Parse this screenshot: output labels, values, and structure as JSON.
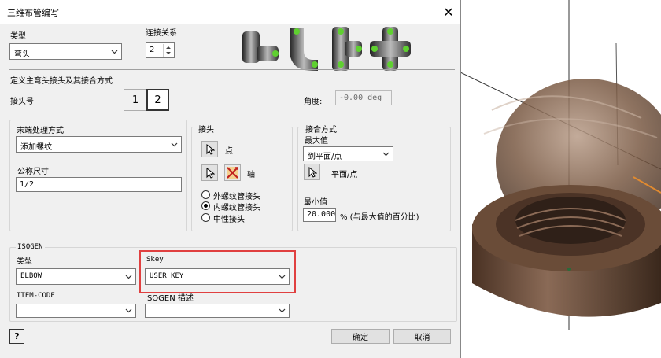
{
  "dialog": {
    "title": "三维布管编写",
    "type_label": "类型",
    "type_value": "弯头",
    "connections_label": "连接关系",
    "connections_value": "2",
    "define_header": "定义主弯头接头及其接合方式",
    "connector_label": "接头号",
    "connector_buttons": [
      "1",
      "2"
    ],
    "angle_label": "角度:",
    "angle_value": "-0.00 deg",
    "end_treatment": {
      "title": "末端处理方式",
      "value": "添加螺纹",
      "nominal_size_label": "公称尺寸",
      "nominal_size_value": "1/2"
    },
    "connector": {
      "title": "接头",
      "point_label": "点",
      "axis_label": "轴",
      "radios": [
        {
          "label": "外螺纹管接头",
          "selected": false
        },
        {
          "label": "内螺纹管接头",
          "selected": true
        },
        {
          "label": "中性接头",
          "selected": false
        }
      ]
    },
    "engagement": {
      "title": "接合方式",
      "max_label": "最大值",
      "max_value": "到平面/点",
      "plane_point_label": "平面/点",
      "min_label": "最小值",
      "min_value": "20.000",
      "min_suffix": "% (与最大值的百分比)"
    },
    "isogen": {
      "title": "ISOGEN",
      "type_label": "类型",
      "type_value": "ELBOW",
      "skey_label": "Skey",
      "skey_value": "USER_KEY",
      "item_code_label": "ITEM-CODE",
      "item_code_value": "",
      "desc_label": "ISOGEN 描述",
      "desc_value": ""
    },
    "ok_label": "确定",
    "cancel_label": "取消",
    "help_label": "?"
  },
  "colors": {
    "highlight_box": "#e04040",
    "title_bg": "#ffffff",
    "dialog_bg": "#f0f0f0",
    "model_brown": "#6b4a36"
  }
}
